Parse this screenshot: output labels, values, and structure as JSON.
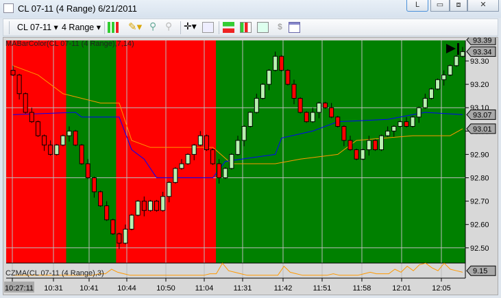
{
  "window": {
    "title": "CL 07-11 (4 Range)  6/21/2011",
    "buttons": {
      "L": "L"
    }
  },
  "toolbar": {
    "instrument": "CL 07-11",
    "period": "4 Range"
  },
  "chart": {
    "indicator_label": "MABarColor(CL 07-11 (4 Range),7,14)",
    "sub_label": "CZMA(CL 07-11 (4 Range),3)",
    "colors": {
      "red": "#ff0000",
      "green": "#008000",
      "up": "#b8f0b0",
      "down": "#ff0000",
      "blue": "#0000ff",
      "orange": "#ff9900"
    },
    "price_ticks": [
      "93.30",
      "93.20",
      "93.10",
      "93.00",
      "92.90",
      "92.80",
      "92.70",
      "92.60",
      "92.50"
    ],
    "price_tick_values": [
      93.3,
      93.2,
      93.1,
      93.0,
      92.9,
      92.8,
      92.7,
      92.6,
      92.5
    ],
    "price_markers": [
      {
        "label": "93.39",
        "value": 93.39
      },
      {
        "label": "93.34",
        "value": 93.34
      },
      {
        "label": "93.07",
        "value": 93.07
      },
      {
        "label": "93.01",
        "value": 93.01
      }
    ],
    "sub_marker": "9.15",
    "time_labels": [
      "10:27:11",
      "10:31",
      "10:41",
      "10:44",
      "10:50",
      "11:04",
      "11:31",
      "11:42",
      "11:51",
      "11:58",
      "12:01",
      "12:05"
    ],
    "regions": [
      {
        "color": "red",
        "from": 0,
        "to": 9
      },
      {
        "color": "green",
        "from": 9,
        "to": 17
      },
      {
        "color": "red",
        "from": 17,
        "to": 33
      },
      {
        "color": "green",
        "from": 33,
        "to": 73
      }
    ],
    "closes": [
      93.24,
      93.16,
      93.08,
      93.04,
      92.98,
      92.94,
      92.9,
      92.94,
      92.98,
      93.0,
      92.94,
      92.86,
      92.8,
      92.74,
      92.68,
      92.62,
      92.56,
      92.52,
      92.58,
      92.64,
      92.7,
      92.66,
      92.7,
      92.66,
      92.72,
      92.78,
      92.84,
      92.86,
      92.9,
      92.94,
      92.98,
      92.92,
      92.86,
      92.8,
      92.84,
      92.9,
      92.96,
      93.02,
      93.08,
      93.14,
      93.2,
      93.26,
      93.32,
      93.26,
      93.2,
      93.14,
      93.08,
      93.04,
      93.08,
      93.12,
      93.1,
      93.06,
      93.02,
      92.96,
      92.92,
      92.88,
      92.92,
      92.96,
      92.92,
      92.98,
      93.0,
      93.02,
      93.04,
      93.02,
      93.06,
      93.1,
      93.14,
      93.18,
      93.22,
      93.24,
      93.28,
      93.32,
      93.34
    ],
    "blue_line": [
      [
        0,
        93.07
      ],
      [
        10,
        93.08
      ],
      [
        11,
        93.06
      ],
      [
        17,
        93.06
      ],
      [
        19,
        92.92
      ],
      [
        21,
        92.88
      ],
      [
        23,
        92.8
      ],
      [
        32,
        92.8
      ],
      [
        34,
        92.87
      ],
      [
        42,
        92.9
      ],
      [
        43,
        92.97
      ],
      [
        48,
        93.0
      ],
      [
        52,
        93.04
      ],
      [
        60,
        93.05
      ],
      [
        66,
        93.08
      ],
      [
        72,
        93.07
      ]
    ],
    "orange_line": [
      [
        0,
        93.28
      ],
      [
        4,
        93.24
      ],
      [
        8,
        93.16
      ],
      [
        14,
        93.12
      ],
      [
        17,
        93.12
      ],
      [
        19,
        92.96
      ],
      [
        22,
        92.93
      ],
      [
        32,
        92.93
      ],
      [
        35,
        92.86
      ],
      [
        42,
        92.86
      ],
      [
        46,
        92.88
      ],
      [
        52,
        92.9
      ],
      [
        55,
        92.96
      ],
      [
        64,
        92.98
      ],
      [
        70,
        92.98
      ],
      [
        72,
        93.01
      ]
    ],
    "sub_series": [
      1,
      1,
      1,
      1,
      1,
      1,
      1,
      1,
      1,
      1,
      1,
      1,
      1,
      1,
      2,
      2,
      5,
      3,
      2,
      1,
      1,
      1,
      1,
      1,
      1,
      1,
      1,
      1,
      1,
      1,
      1,
      1,
      2,
      2,
      9,
      4,
      3,
      2,
      1,
      1,
      1,
      1,
      1,
      1,
      7,
      3,
      2,
      1,
      1,
      1,
      1,
      1,
      2,
      1,
      1,
      1,
      1,
      2,
      3,
      2,
      2,
      2,
      5,
      3,
      7,
      4,
      8,
      9,
      6,
      4,
      9,
      5,
      4,
      3
    ]
  }
}
